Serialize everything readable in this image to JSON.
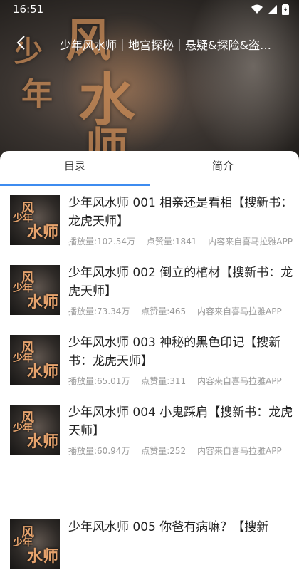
{
  "status": {
    "time": "16:51"
  },
  "header": {
    "title": "少年风水师｜地宫探秘｜悬疑&探险&盗墓…",
    "art_chars": [
      "少",
      "年",
      "风",
      "水",
      "师"
    ]
  },
  "tabs": [
    "目录",
    "简介"
  ],
  "episodes": [
    {
      "title": "少年风水师 001 相亲还是看相【搜新书：龙虎天师】",
      "plays": "播放量:102.54万",
      "likes": "点赞量:1841",
      "source": "内容来自喜马拉雅APP"
    },
    {
      "title": "少年风水师 002 倒立的棺材【搜新书：龙虎天师】",
      "plays": "播放量:73.34万",
      "likes": "点赞量:465",
      "source": "内容来自喜马拉雅APP"
    },
    {
      "title": "少年风水师 003 神秘的黑色印记【搜新书：龙虎天师】",
      "plays": "播放量:65.01万",
      "likes": "点赞量:311",
      "source": "内容来自喜马拉雅APP"
    },
    {
      "title": "少年风水师 004 小鬼踩肩【搜新书：龙虎天师】",
      "plays": "播放量:60.94万",
      "likes": "点赞量:252",
      "source": "内容来自喜马拉雅APP"
    },
    {
      "title": "少年风水师 005 你爸有病嘛？【搜新",
      "plays": "",
      "likes": "",
      "source": ""
    }
  ],
  "thumb_chars": [
    "风",
    "少年",
    "水师"
  ],
  "colors": {
    "accent": "#3d8cf0"
  }
}
